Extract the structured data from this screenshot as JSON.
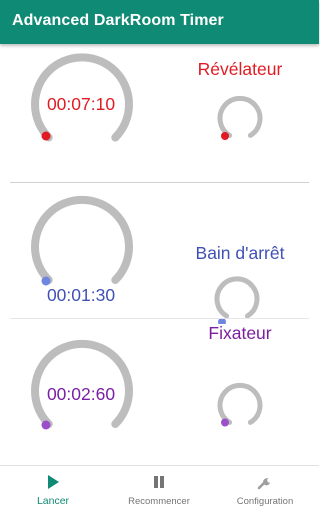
{
  "app": {
    "title": "Advanced DarkRoom Timer",
    "accent_color": "#0f8a74"
  },
  "timers": [
    {
      "time": "00:07:10",
      "label": "Révélateur",
      "color": "#e01b24"
    },
    {
      "time": "00:01:30",
      "label": "Bain d'arrêt",
      "color": "#3f51b5"
    },
    {
      "time": "00:02:60",
      "label": "Fixateur",
      "color": "#7b1fa2"
    }
  ],
  "bottom_nav": {
    "items": [
      {
        "label": "Lancer",
        "icon": "play-icon",
        "active": true
      },
      {
        "label": "Recommencer",
        "icon": "pause-icon",
        "active": false
      },
      {
        "label": "Configuration",
        "icon": "wrench-icon",
        "active": false
      }
    ]
  }
}
